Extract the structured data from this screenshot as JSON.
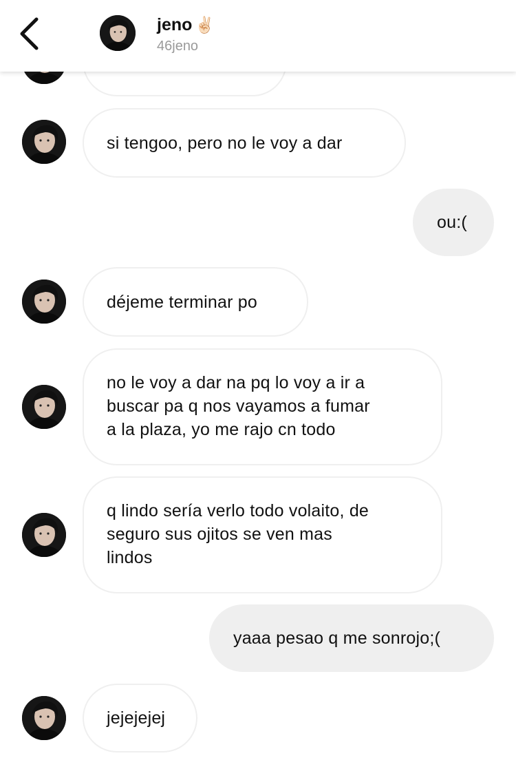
{
  "header": {
    "back_label": "Back",
    "name": "jeno",
    "name_emoji": "✌🏻",
    "username": "46jeno"
  },
  "messages": [
    {
      "id": 1,
      "direction": "incoming",
      "text": ""
    },
    {
      "id": 2,
      "direction": "incoming",
      "text": "si tengoo, pero no le voy a dar"
    },
    {
      "id": 3,
      "direction": "outgoing",
      "text": "ou:("
    },
    {
      "id": 4,
      "direction": "incoming",
      "text": "déjeme terminar po"
    },
    {
      "id": 5,
      "direction": "incoming",
      "lines": [
        "no le voy a dar na pq lo voy a ir a",
        "buscar pa q nos vayamos a fumar",
        "a la plaza, yo me rajo cn todo"
      ]
    },
    {
      "id": 6,
      "direction": "incoming",
      "lines": [
        "q lindo sería verlo todo volaito, de",
        "seguro sus ojitos se ven mas",
        "lindos"
      ]
    },
    {
      "id": 7,
      "direction": "outgoing",
      "text": "yaaa pesao q me sonrojo;("
    },
    {
      "id": 8,
      "direction": "incoming",
      "text": "jejejejej"
    }
  ],
  "colors": {
    "incoming_bubble_bg": "#ffffff",
    "incoming_bubble_border": "#efefef",
    "outgoing_bubble_bg": "#efefef",
    "username": "#9a9a9a",
    "text": "#111111"
  },
  "icons": {
    "back": "chevron-left-icon",
    "avatar": "profile-photo"
  }
}
